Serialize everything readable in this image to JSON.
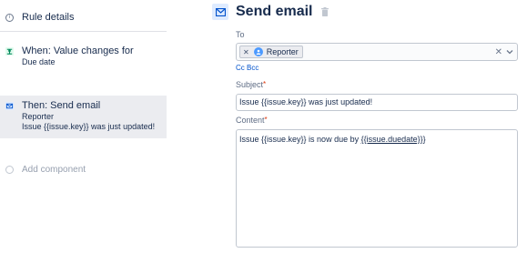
{
  "sidebar": {
    "rule_details": "Rule details",
    "components": [
      {
        "title": "When: Value changes for",
        "lines": [
          "Due date"
        ]
      },
      {
        "title": "Then: Send email",
        "lines": [
          "Reporter",
          "Issue {{issue.key}} was just updated!"
        ]
      }
    ],
    "add_component": "Add component"
  },
  "action": {
    "title": "Send email",
    "to": {
      "label": "To",
      "recipients": [
        "Reporter"
      ],
      "cc_bcc": "Cc Bcc"
    },
    "subject": {
      "label": "Subject",
      "value": "Issue {{issue.key}} was just updated!"
    },
    "content": {
      "label": "Content",
      "prefix": "Issue {{issue.key}} is now due by ",
      "underlined": "{{issue.duedate}}",
      "suffix": "}"
    },
    "required_marker": "*"
  },
  "colors": {
    "accent": "#0052cc",
    "selected_bg": "#ebecf0",
    "required": "#de350b"
  }
}
